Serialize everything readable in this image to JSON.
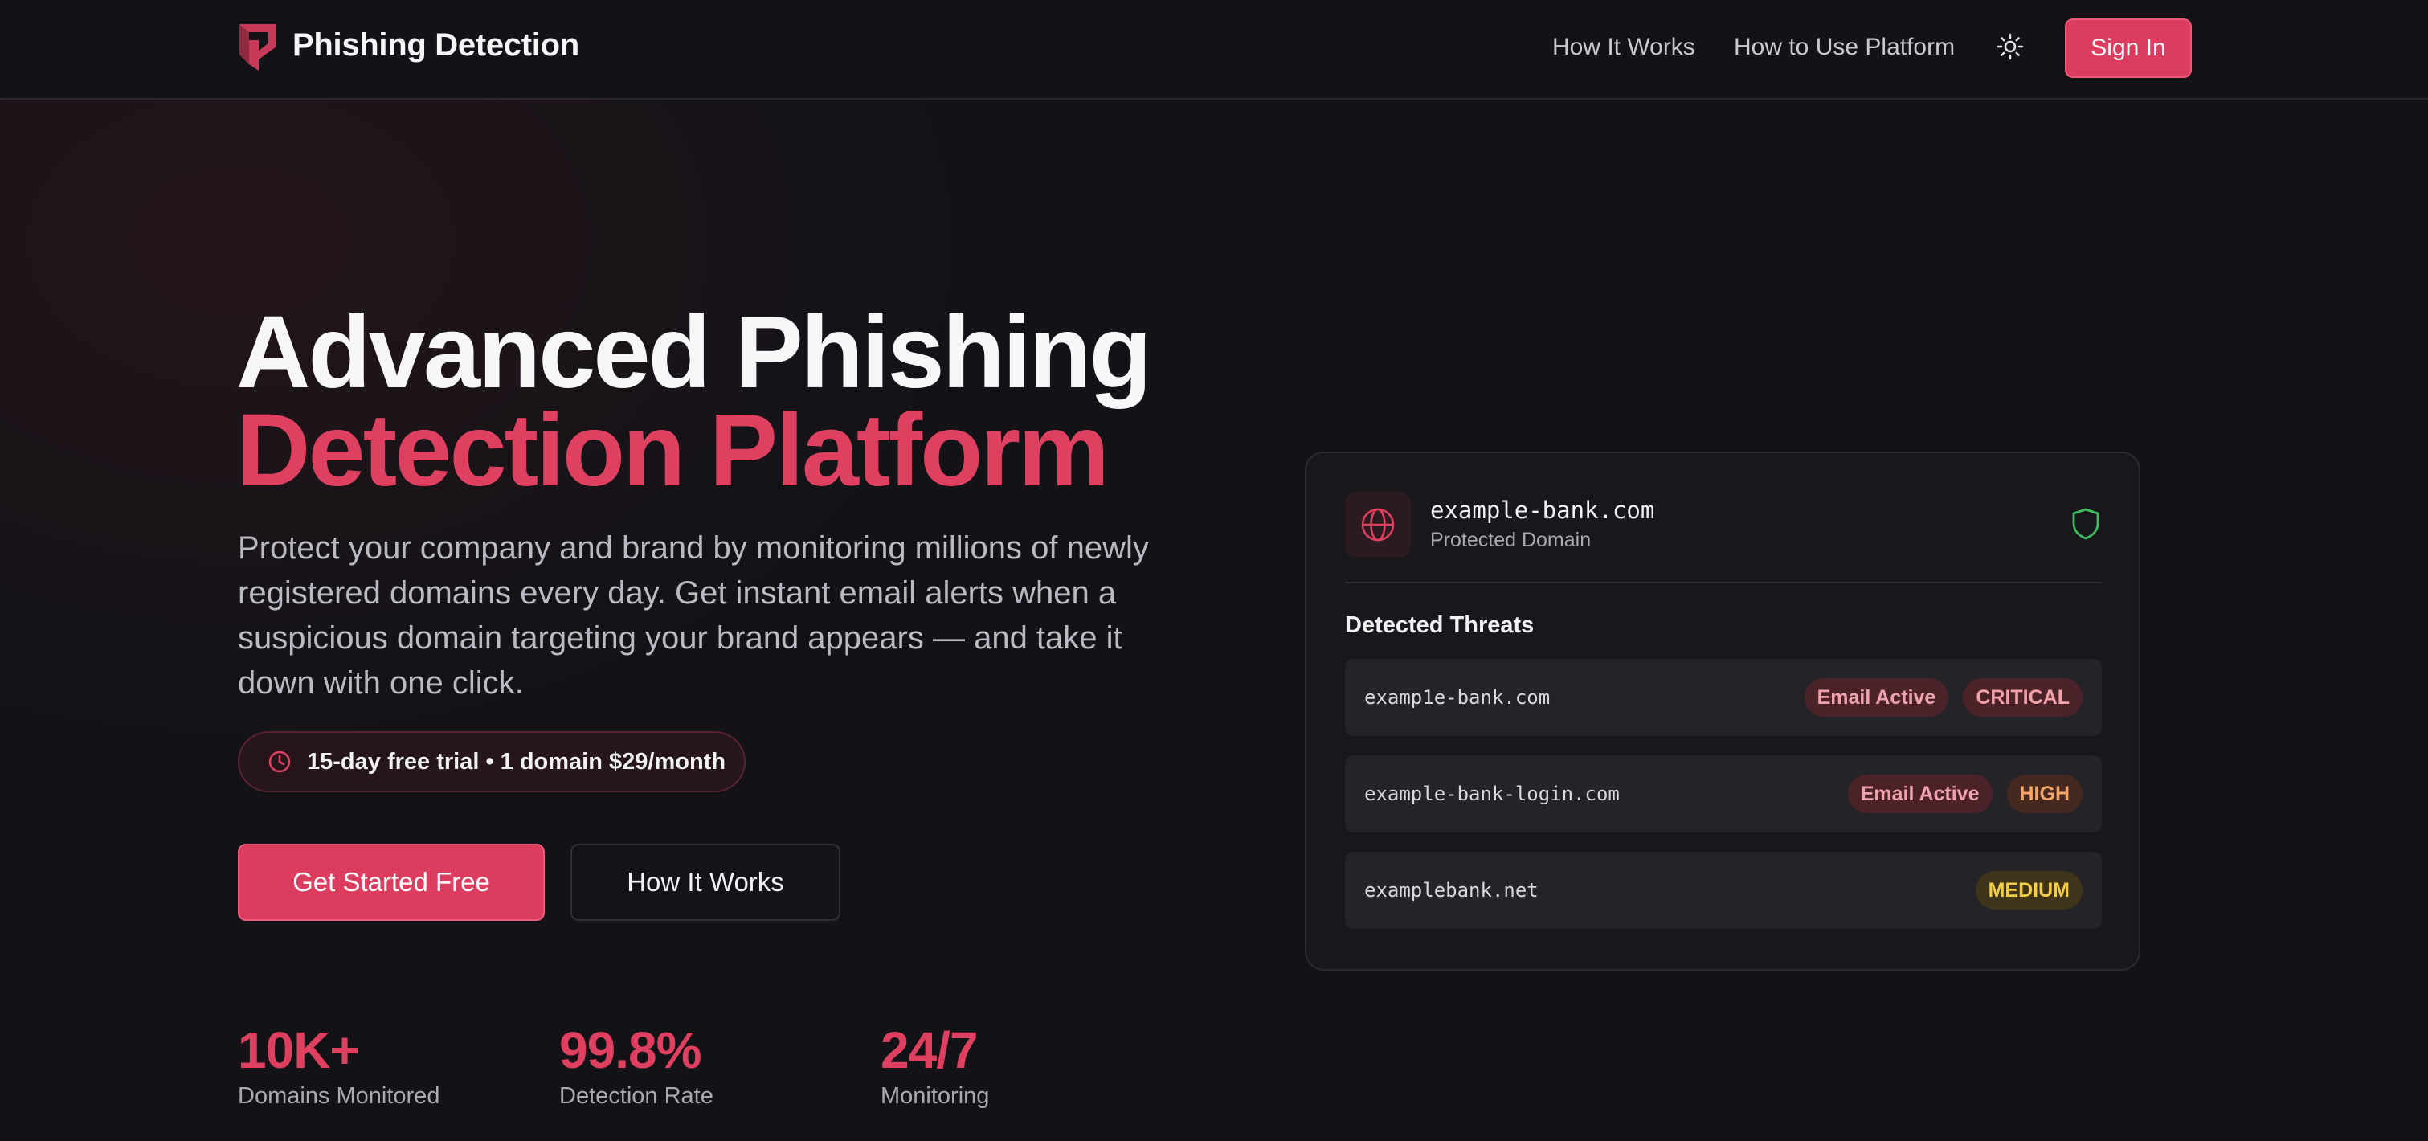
{
  "header": {
    "brand": "Phishing Detection",
    "nav": [
      {
        "label": "How It Works"
      },
      {
        "label": "How to Use Platform"
      }
    ],
    "theme_icon": "sun-icon",
    "signin_label": "Sign In"
  },
  "hero": {
    "title_line1": "Advanced Phishing",
    "title_line2": "Detection Platform",
    "description": "Protect your company and brand by monitoring millions of newly registered domains every day. Get instant email alerts when a suspicious domain targeting your brand appears — and take it down with one click.",
    "trial_badge": "15-day free trial • 1 domain $29/month",
    "primary_button": "Get Started Free",
    "secondary_button": "How It Works"
  },
  "stats": [
    {
      "value": "10K+",
      "label": "Domains Monitored"
    },
    {
      "value": "99.8%",
      "label": "Detection Rate"
    },
    {
      "value": "24/7",
      "label": "Monitoring"
    }
  ],
  "card": {
    "domain": "example-bank.com",
    "domain_subtitle": "Protected Domain",
    "threats_title": "Detected Threats",
    "threats": [
      {
        "domain": "examp1e-bank.com",
        "email_tag": "Email Active",
        "severity": "CRITICAL"
      },
      {
        "domain": "example-bank-login.com",
        "email_tag": "Email Active",
        "severity": "HIGH"
      },
      {
        "domain": "examplebank.net",
        "severity": "MEDIUM"
      }
    ]
  },
  "colors": {
    "accent": "#dc3d5f",
    "background": "#131317",
    "card": "#18181c",
    "shield_ok": "#3fbf5f"
  }
}
